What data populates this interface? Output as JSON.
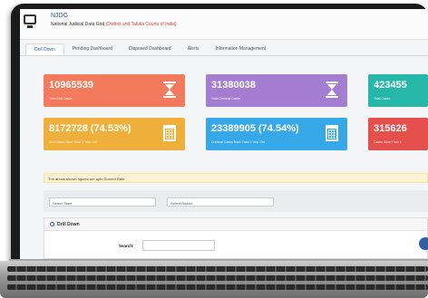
{
  "header": {
    "title": "NJDG",
    "subtitle_prefix": "National Judicial Data Grid",
    "subtitle_accent": "(District and Taluka Courts of India)"
  },
  "tabs": [
    {
      "label": "Drill Down",
      "active": true
    },
    {
      "label": "Pending Dashboard",
      "active": false
    },
    {
      "label": "Disposed Dashboard",
      "active": false
    },
    {
      "label": "Alerts",
      "active": false
    },
    {
      "label": "Information Management",
      "active": false
    }
  ],
  "cards": {
    "total_civil": {
      "value": "10965539",
      "caption": "Total Civil Cases",
      "color": "#f47a5e",
      "icon": "hourglass-icon"
    },
    "total_criminal": {
      "value": "31380038",
      "caption": "Total Criminal Cases",
      "color": "#a47dd0",
      "icon": "hourglass-icon"
    },
    "total_cases": {
      "value": "423455",
      "caption": "Total Cases",
      "color": "#26b7a8"
    },
    "civil_old": {
      "value": "8172728 (74.53%)",
      "caption": "Civil Cases More Than 1 Year Old",
      "color": "#eeb03a",
      "icon": "calendar-icon"
    },
    "criminal_old": {
      "value": "23389905 (74.54%)",
      "caption": "Criminal Cases More Than 1 Year Old",
      "color": "#36a8e8",
      "icon": "calendar-icon"
    },
    "cases_old": {
      "value": "315626",
      "caption": "Cases More Than 1",
      "color": "#e6504c"
    }
  },
  "note": "The above shown figures are upto Current Date",
  "filters": {
    "state_placeholder": "Select State",
    "district_placeholder": "Select District"
  },
  "drill_down": {
    "title": "Drill Down",
    "search_label": "Search:"
  }
}
